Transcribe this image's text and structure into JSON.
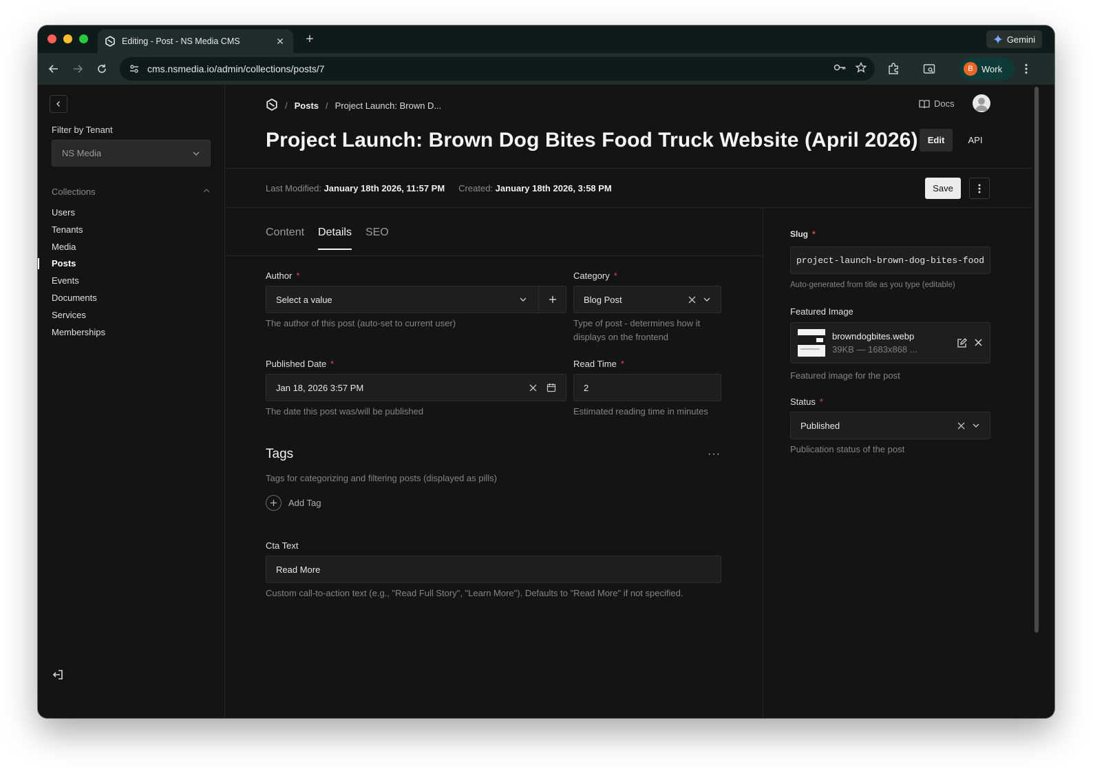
{
  "browser": {
    "tab_title": "Editing - Post - NS Media CMS",
    "url": "cms.nsmedia.io/admin/collections/posts/7",
    "gemini_label": "Gemini",
    "profile_initial": "B",
    "profile_label": "Work",
    "close_glyph": "✕",
    "new_tab_glyph": "+"
  },
  "sidebar": {
    "filter_label": "Filter by Tenant",
    "tenant_value": "NS Media",
    "collections_label": "Collections",
    "items": [
      {
        "label": "Users"
      },
      {
        "label": "Tenants"
      },
      {
        "label": "Media"
      },
      {
        "label": "Posts",
        "active": true
      },
      {
        "label": "Events"
      },
      {
        "label": "Documents"
      },
      {
        "label": "Services"
      },
      {
        "label": "Memberships"
      }
    ]
  },
  "header": {
    "breadcrumb": {
      "sep": "/",
      "collection": "Posts",
      "current": "Project Launch: Brown D..."
    },
    "docs_label": "Docs",
    "title": "Project Launch: Brown Dog Bites Food Truck Website (April 2026)",
    "edit_label": "Edit",
    "api_label": "API",
    "last_modified_label": "Last Modified:",
    "last_modified_value": "January 18th 2026, 11:57 PM",
    "created_label": "Created:",
    "created_value": "January 18th 2026, 3:58 PM",
    "save_label": "Save"
  },
  "tabs": [
    {
      "label": "Content"
    },
    {
      "label": "Details",
      "active": true
    },
    {
      "label": "SEO"
    }
  ],
  "required_mark": "*",
  "fields": {
    "author": {
      "label": "Author",
      "placeholder": "Select a value",
      "hint": "The author of this post (auto-set to current user)"
    },
    "category": {
      "label": "Category",
      "value": "Blog Post",
      "hint": "Type of post - determines how it displays on the frontend"
    },
    "published_date": {
      "label": "Published Date",
      "value": "Jan 18, 2026 3:57 PM",
      "hint": "The date this post was/will be published"
    },
    "read_time": {
      "label": "Read Time",
      "value": "2",
      "hint": "Estimated reading time in minutes"
    },
    "tags": {
      "title": "Tags",
      "more": "···",
      "hint": "Tags for categorizing and filtering posts (displayed as pills)",
      "add_label": "Add Tag"
    },
    "cta_text": {
      "label": "Cta Text",
      "value": "Read More",
      "hint": "Custom call-to-action text (e.g., \"Read Full Story\", \"Learn More\"). Defaults to \"Read More\" if not specified."
    }
  },
  "sidebar_fields": {
    "slug": {
      "label": "Slug",
      "value": "project-launch-brown-dog-bites-food-",
      "hint": "Auto-generated from title as you type (editable)"
    },
    "featured_image": {
      "label": "Featured Image",
      "filename": "browndogbites.webp",
      "size": "39KB — 1683x868 ...",
      "hint": "Featured image for the post"
    },
    "status": {
      "label": "Status",
      "value": "Published",
      "hint": "Publication status of the post"
    }
  },
  "colors": {
    "accent_required": "#e5484d",
    "background": "#141414",
    "save_button": "#ececec"
  }
}
